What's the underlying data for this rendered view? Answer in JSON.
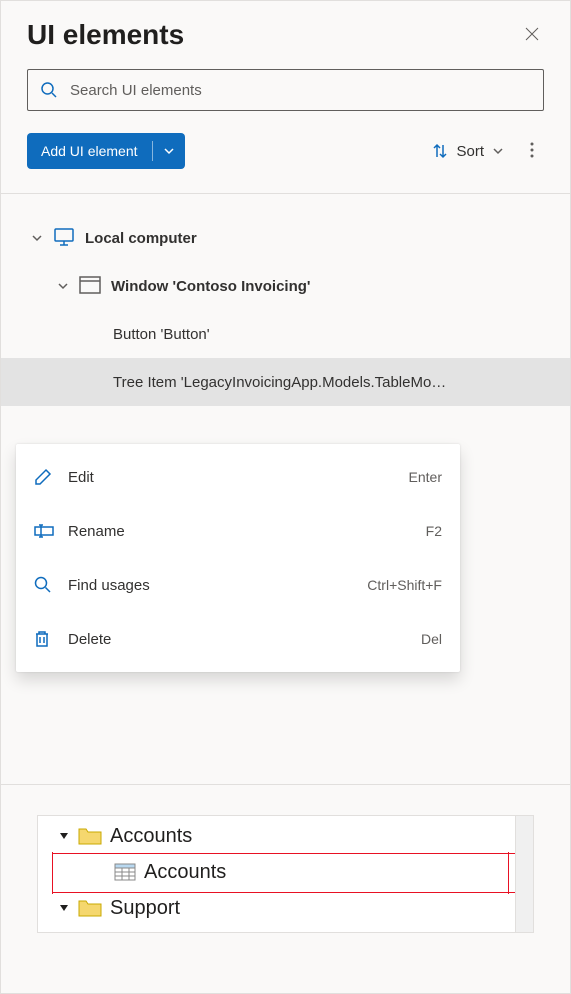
{
  "header": {
    "title": "UI elements"
  },
  "search": {
    "placeholder": "Search UI elements"
  },
  "toolbar": {
    "add_label": "Add UI element",
    "sort_label": "Sort"
  },
  "tree": {
    "root": {
      "label": "Local computer"
    },
    "window": {
      "label": "Window 'Contoso Invoicing'"
    },
    "child1": {
      "label": "Button 'Button'"
    },
    "child2": {
      "label": "Tree Item 'LegacyInvoicingApp.Models.TableMo…"
    }
  },
  "context_menu": {
    "items": [
      {
        "icon": "edit-icon",
        "label": "Edit",
        "shortcut": "Enter"
      },
      {
        "icon": "rename-icon",
        "label": "Rename",
        "shortcut": "F2"
      },
      {
        "icon": "search-icon",
        "label": "Find usages",
        "shortcut": "Ctrl+Shift+F"
      },
      {
        "icon": "delete-icon",
        "label": "Delete",
        "shortcut": "Del"
      }
    ]
  },
  "preview": {
    "row1": "Accounts",
    "row2": "Accounts",
    "row3": "Support"
  }
}
